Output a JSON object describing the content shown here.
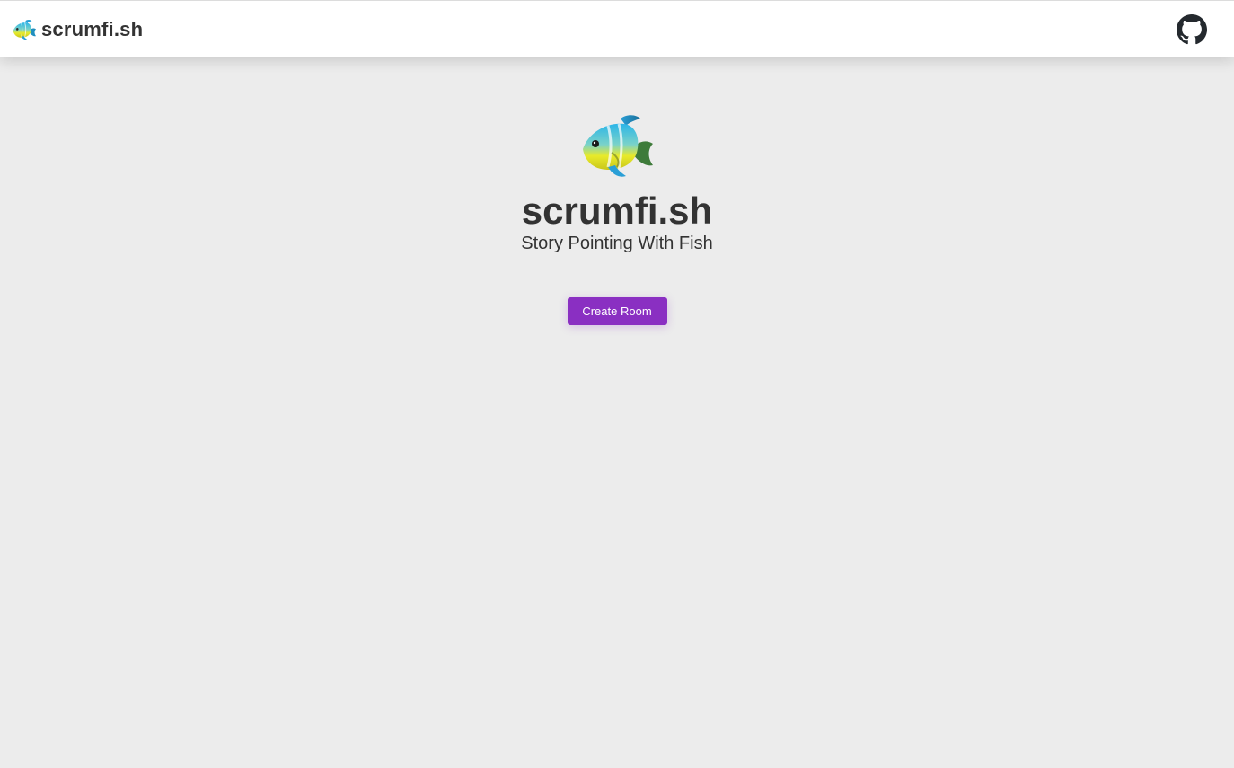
{
  "header": {
    "brand_icon": "tropical-fish-icon",
    "brand_name": "scrumfi.sh",
    "github_icon": "github-icon"
  },
  "hero": {
    "icon": "tropical-fish-icon",
    "title": "scrumfi.sh",
    "subtitle": "Story Pointing With Fish",
    "create_room_label": "Create Room"
  },
  "colors": {
    "background": "#ececec",
    "header_background": "#ffffff",
    "text": "#333333",
    "accent": "#8a2fc2"
  }
}
